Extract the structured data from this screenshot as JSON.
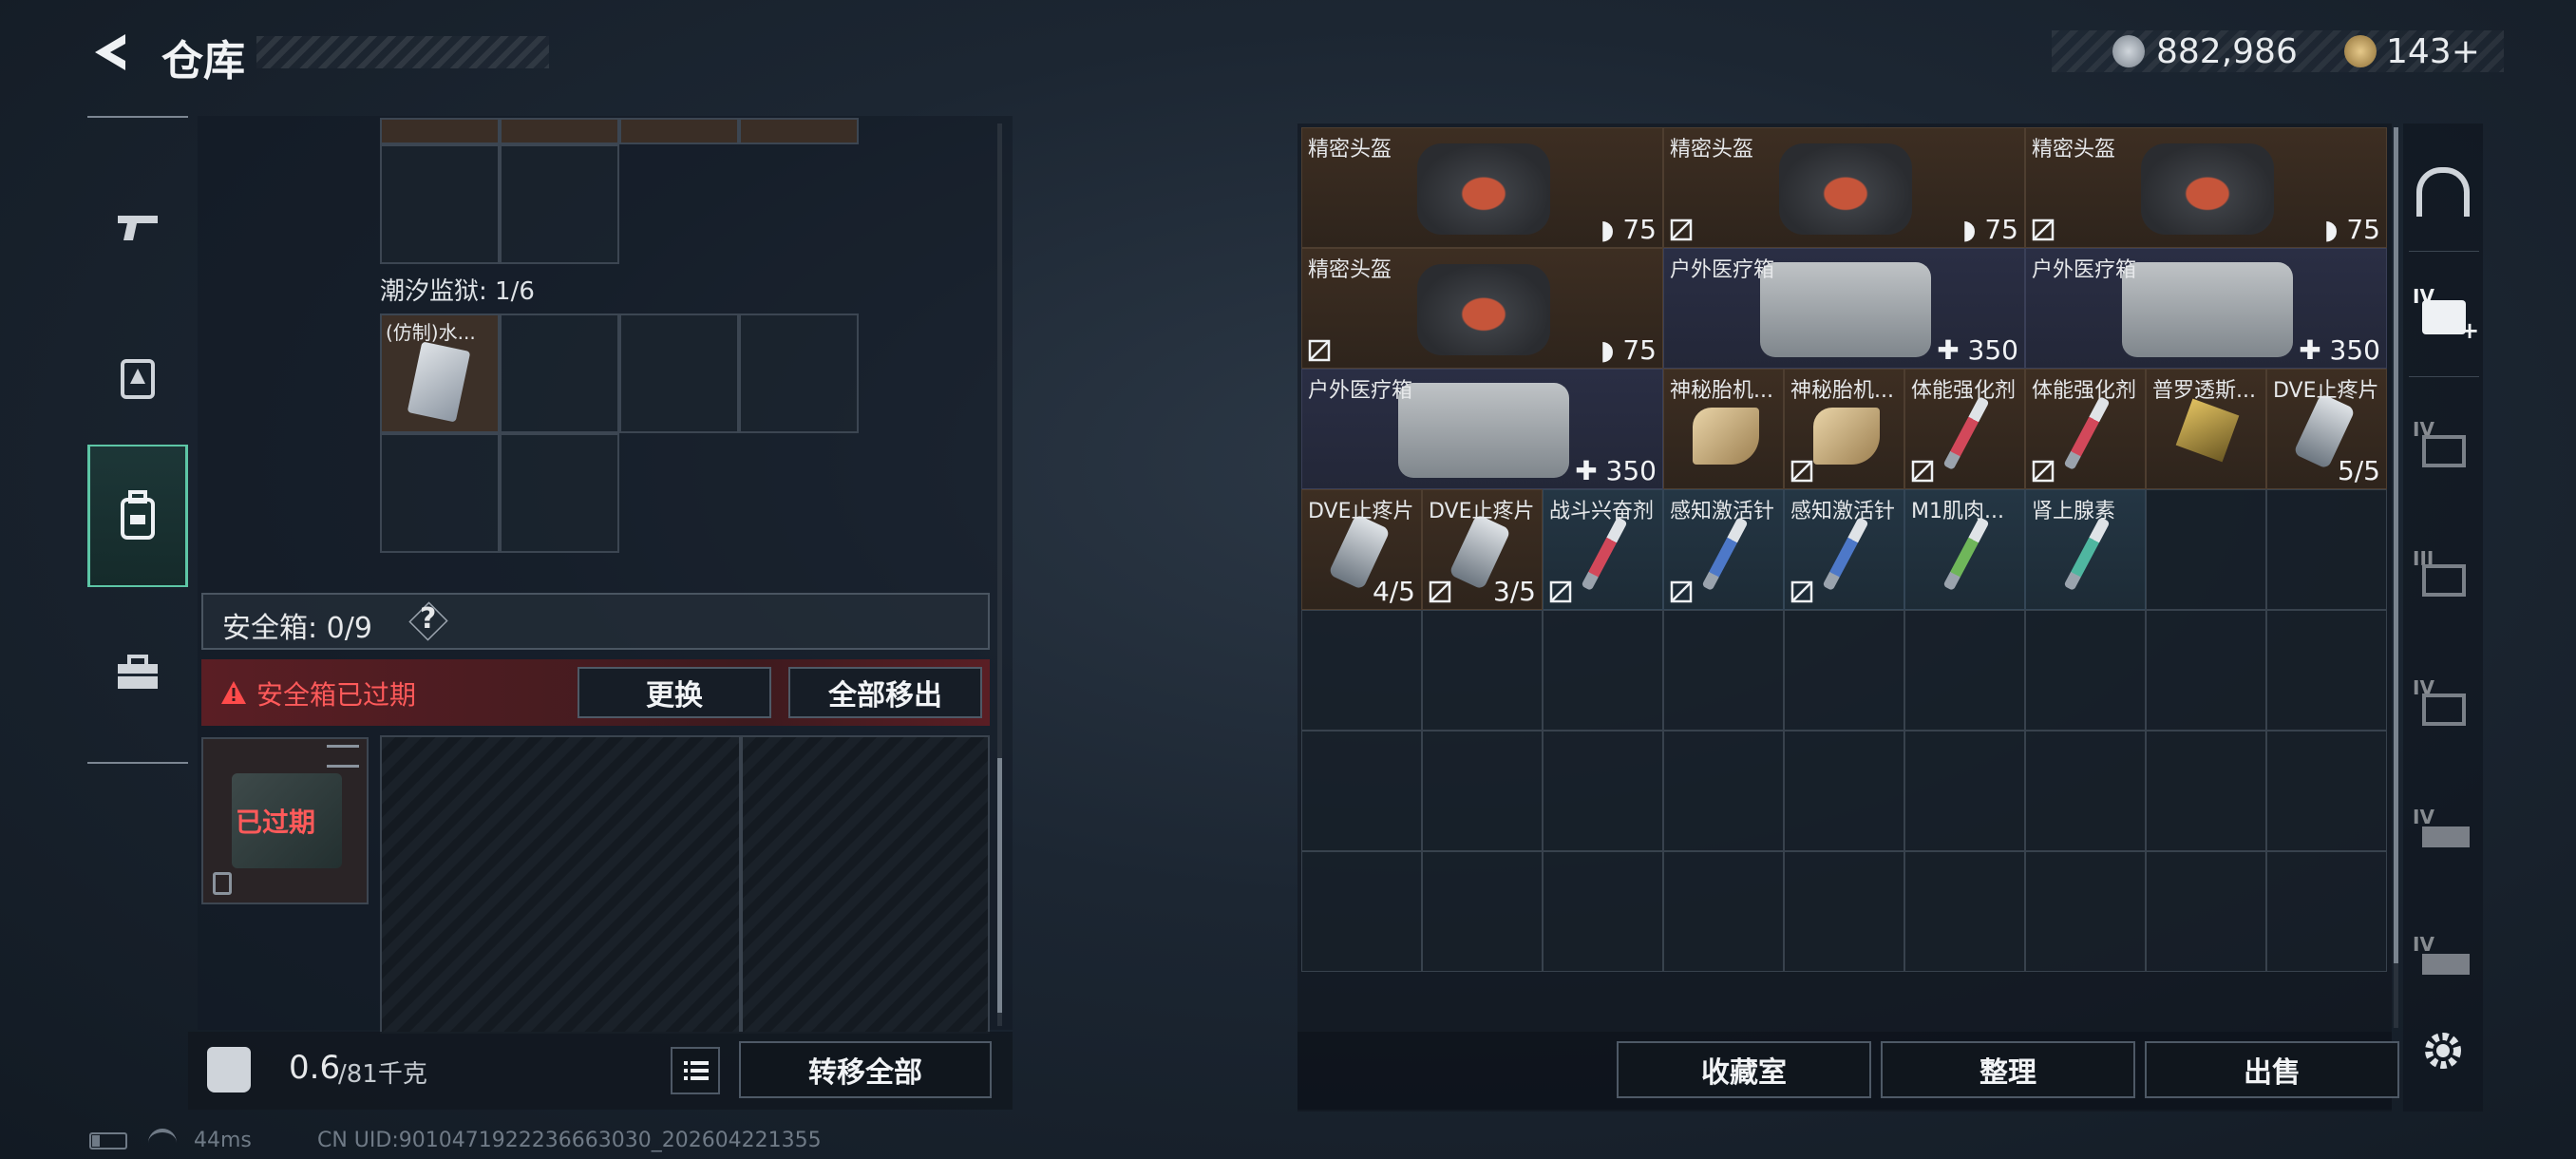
{
  "header": {
    "title": "仓库",
    "currency_silver": "882,986",
    "currency_gold": "143+"
  },
  "left": {
    "prison_label": "潮汐监狱: 1/6",
    "prison_item": "(仿制)水...",
    "safebox_label": "安全箱: 0/9",
    "safebox_help": "?",
    "warning": "安全箱已过期",
    "btn_replace": "更换",
    "btn_move_all_out": "全部移出",
    "expired_label": "已过期",
    "weight": "0.6",
    "weight_max": "/81千克",
    "btn_transfer_all": "转移全部"
  },
  "stash": {
    "items": [
      {
        "name": "精密头盔",
        "value": "75"
      },
      {
        "name": "精密头盔",
        "value": "75"
      },
      {
        "name": "精密头盔",
        "value": "75"
      },
      {
        "name": "精密头盔",
        "value": "75"
      },
      {
        "name": "户外医疗箱",
        "value": "350"
      },
      {
        "name": "户外医疗箱",
        "value": "350"
      },
      {
        "name": "户外医疗箱",
        "value": "350"
      },
      {
        "name": "神秘胎机...",
        "value": ""
      },
      {
        "name": "神秘胎机...",
        "value": ""
      },
      {
        "name": "体能强化剂",
        "value": ""
      },
      {
        "name": "体能强化剂",
        "value": ""
      },
      {
        "name": "普罗透斯...",
        "value": ""
      },
      {
        "name": "DVE止疼片",
        "value": "5/5"
      },
      {
        "name": "DVE止疼片",
        "value": "4/5"
      },
      {
        "name": "DVE止疼片",
        "value": "3/5"
      },
      {
        "name": "战斗兴奋剂",
        "value": ""
      },
      {
        "name": "感知激活针",
        "value": ""
      },
      {
        "name": "感知激活针",
        "value": ""
      },
      {
        "name": "M1肌肉...",
        "value": ""
      },
      {
        "name": "肾上腺素",
        "value": ""
      }
    ]
  },
  "footer": {
    "btn_collection": "收藏室",
    "btn_sort": "整理",
    "btn_sell": "出售"
  },
  "rail": {
    "tier_labels": [
      "IV",
      "IV",
      "III",
      "IV",
      "IV",
      "IV"
    ]
  },
  "status": {
    "ping": "44ms",
    "uid": "CN UID:9010471922236663030_202604221355"
  }
}
